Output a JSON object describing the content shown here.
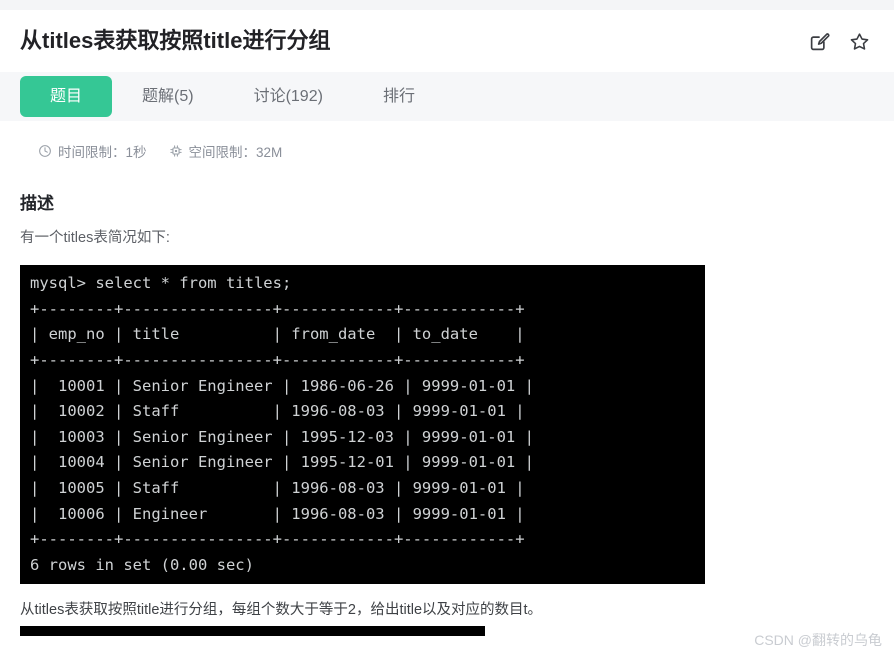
{
  "header": {
    "title": "从titles表获取按照title进行分组",
    "actions": [
      {
        "name": "edit-icon",
        "label": "编辑"
      },
      {
        "name": "star-icon",
        "label": "收藏"
      }
    ]
  },
  "tabs": [
    {
      "label": "题目",
      "active": true
    },
    {
      "label": "题解(5)",
      "active": false
    },
    {
      "label": "讨论(192)",
      "active": false
    },
    {
      "label": "排行",
      "active": false
    }
  ],
  "meta": {
    "time_icon": "clock-icon",
    "time_limit": "时间限制：1秒",
    "memory_icon": "memory-chip-icon",
    "memory_limit": "空间限制：32M"
  },
  "description": {
    "heading": "描述",
    "intro": "有一个titles表简况如下:",
    "terminal": "mysql> select * from titles;\n+--------+----------------+------------+------------+\n| emp_no | title          | from_date  | to_date    |\n+--------+----------------+------------+------------+\n|  10001 | Senior Engineer | 1986-06-26 | 9999-01-01 |\n|  10002 | Staff          | 1996-08-03 | 9999-01-01 |\n|  10003 | Senior Engineer | 1995-12-03 | 9999-01-01 |\n|  10004 | Senior Engineer | 1995-12-01 | 9999-01-01 |\n|  10005 | Staff          | 1996-08-03 | 9999-01-01 |\n|  10006 | Engineer       | 1996-08-03 | 9999-01-01 |\n+--------+----------------+------------+------------+\n6 rows in set (0.00 sec)",
    "task": "从titles表获取按照title进行分组，每组个数大于等于2，给出title以及对应的数目t。"
  },
  "watermark": "CSDN @翻转的乌龟",
  "colors": {
    "accent_green": "#35c795",
    "page_gray": "#f4f5f7",
    "tabbar_gray": "#f6f7f9",
    "terminal_bg": "#000000",
    "terminal_fg": "#cfd2d4"
  }
}
